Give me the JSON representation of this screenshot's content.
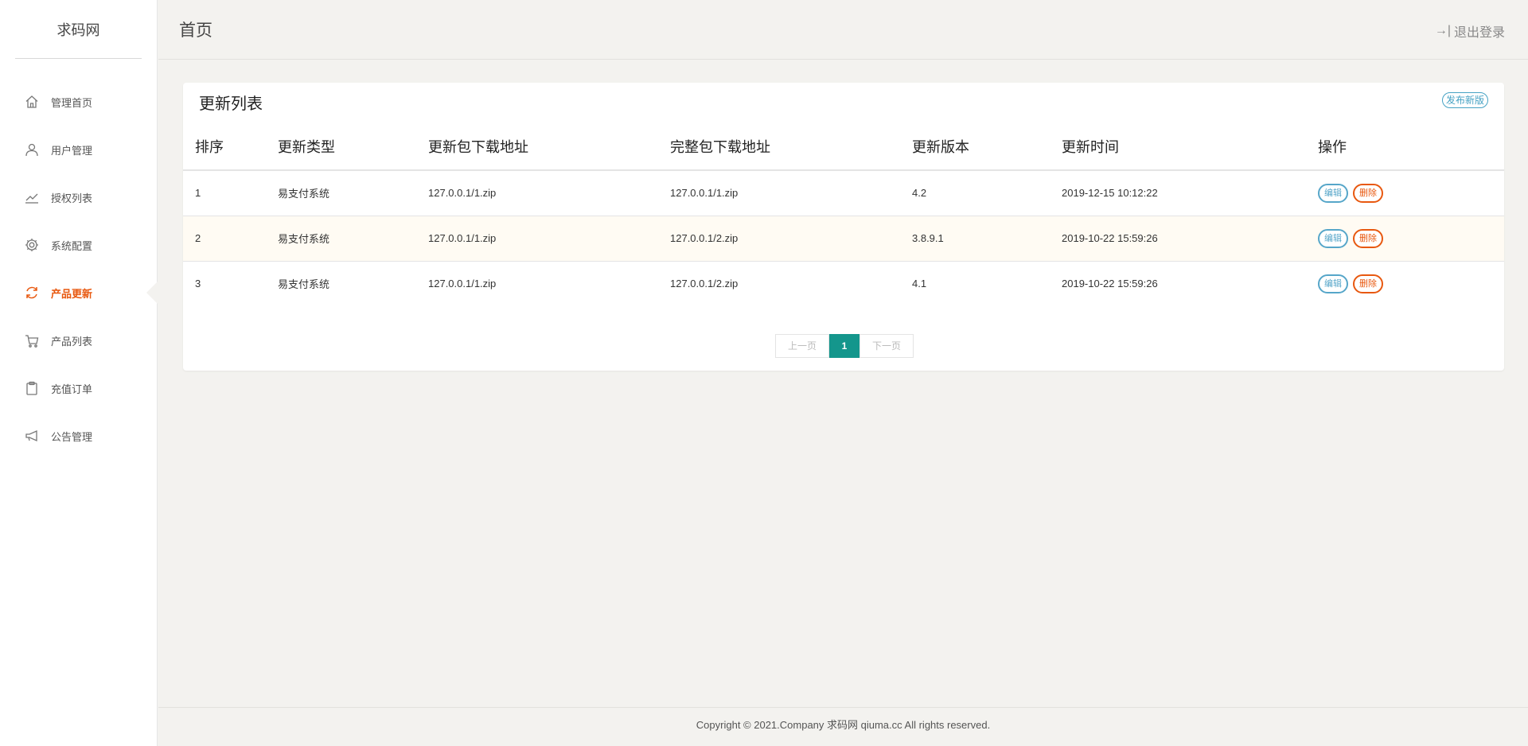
{
  "sidebar": {
    "logo": "求码网",
    "items": [
      {
        "label": "管理首页",
        "icon": "home-icon",
        "active": false
      },
      {
        "label": "用户管理",
        "icon": "user-icon",
        "active": false
      },
      {
        "label": "授权列表",
        "icon": "trend-icon",
        "active": false
      },
      {
        "label": "系统配置",
        "icon": "gear-icon",
        "active": false
      },
      {
        "label": "产品更新",
        "icon": "refresh-icon",
        "active": true
      },
      {
        "label": "产品列表",
        "icon": "cart-icon",
        "active": false
      },
      {
        "label": "充值订单",
        "icon": "clipboard-icon",
        "active": false
      },
      {
        "label": "公告管理",
        "icon": "megaphone-icon",
        "active": false
      }
    ]
  },
  "header": {
    "title": "首页",
    "logout_icon": "→|",
    "logout_label": "退出登录"
  },
  "card": {
    "title": "更新列表",
    "publish_label": "发布新版",
    "columns": [
      "排序",
      "更新类型",
      "更新包下载地址",
      "完整包下载地址",
      "更新版本",
      "更新时间",
      "操作"
    ],
    "rows": [
      {
        "order": "1",
        "type": "易支付系统",
        "update_url": "127.0.0.1/1.zip",
        "full_url": "127.0.0.1/1.zip",
        "version": "4.2",
        "time": "2019-12-15 10:12:22"
      },
      {
        "order": "2",
        "type": "易支付系统",
        "update_url": "127.0.0.1/1.zip",
        "full_url": "127.0.0.1/2.zip",
        "version": "3.8.9.1",
        "time": "2019-10-22 15:59:26"
      },
      {
        "order": "3",
        "type": "易支付系统",
        "update_url": "127.0.0.1/1.zip",
        "full_url": "127.0.0.1/2.zip",
        "version": "4.1",
        "time": "2019-10-22 15:59:26"
      }
    ],
    "edit_label": "编辑",
    "delete_label": "删除"
  },
  "pager": {
    "prev_label": "上一页",
    "current": "1",
    "next_label": "下一页"
  },
  "footer": {
    "copyright": "Copyright © 2021.Company 求码网 qiuma.cc All rights reserved."
  },
  "colors": {
    "accent": "#e8580f",
    "edit": "#56a6c9",
    "pager_active": "#14968c",
    "background": "#f3f2ef"
  }
}
